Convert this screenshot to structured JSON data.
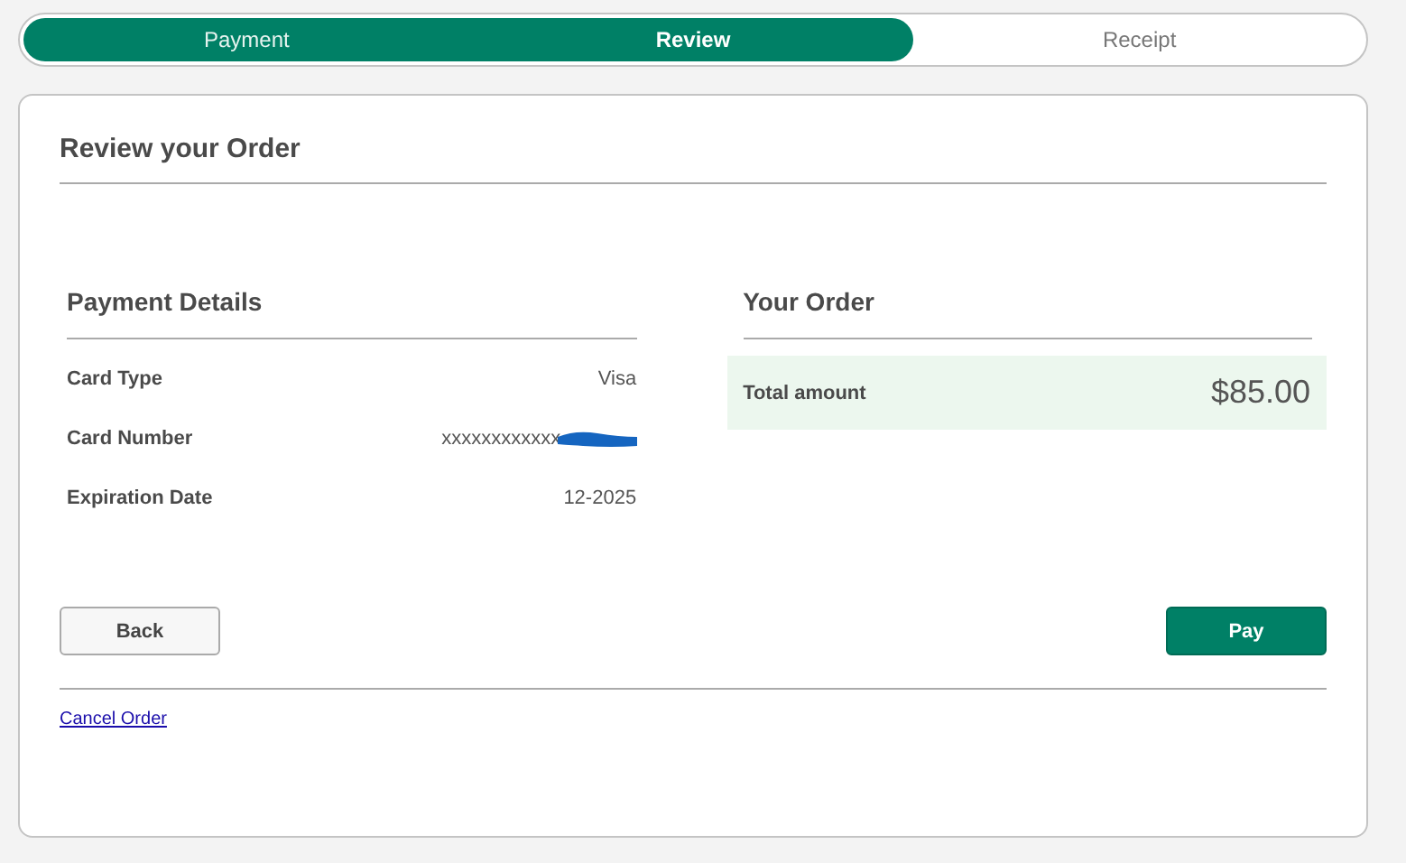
{
  "steps": [
    {
      "label": "Payment",
      "completed": true,
      "selected": false
    },
    {
      "label": "Review",
      "completed": false,
      "selected": true
    },
    {
      "label": "Receipt",
      "completed": false,
      "selected": false
    }
  ],
  "title": "Review your Order",
  "payment_details": {
    "heading": "Payment Details",
    "rows": [
      {
        "label": "Card Type",
        "value": "Visa",
        "redacted": false
      },
      {
        "label": "Card Number",
        "value": "xxxxxxxxxxxx",
        "redacted": true
      },
      {
        "label": "Expiration Date",
        "value": "12-2025",
        "redacted": false
      }
    ]
  },
  "your_order": {
    "heading": "Your Order",
    "total_label": "Total amount",
    "total_value": "$85.00"
  },
  "buttons": [
    {
      "label": "Back",
      "kind": "secondary"
    },
    {
      "label": "Pay",
      "kind": "primary"
    }
  ],
  "cancel_link": "Cancel Order"
}
